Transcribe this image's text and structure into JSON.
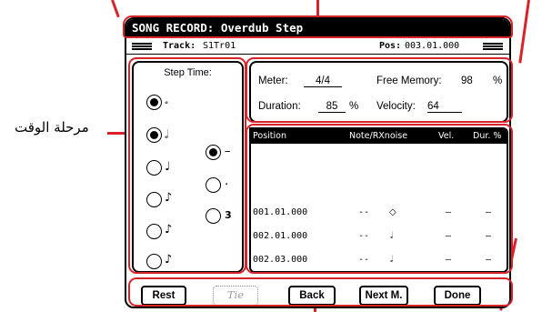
{
  "screen": {
    "title": "SONG RECORD:  Overdub Step",
    "track_label": "Track:",
    "track_value": "S1Tr01",
    "pos_label": "Pos:",
    "pos_value": "003.01.000"
  },
  "step_time": {
    "title": "Step Time:",
    "left_options": [
      {
        "icon": "whole-note-icon",
        "glyph": "𝅗𝅥",
        "selected": true
      },
      {
        "icon": "half-note-icon",
        "glyph": "𝅗𝅥",
        "selected": true
      },
      {
        "icon": "quarter-note-icon",
        "glyph": "♩",
        "selected": false
      },
      {
        "icon": "eighth-note-icon",
        "glyph": "♪",
        "selected": false
      },
      {
        "icon": "sixteenth-note-icon",
        "glyph": "𝅘𝅥𝅯",
        "selected": false
      },
      {
        "icon": "thirty-second-note-icon",
        "glyph": "𝅘𝅥𝅰",
        "selected": false
      }
    ],
    "right_options": [
      {
        "label": "–",
        "selected": true
      },
      {
        "label": ".",
        "selected": false
      },
      {
        "label": "3",
        "selected": false
      }
    ]
  },
  "info": {
    "meter_label": "Meter:",
    "meter_value": "4/4",
    "free_memory_label": "Free Memory:",
    "free_memory_value": "98",
    "free_memory_unit": "%",
    "duration_label": "Duration:",
    "duration_value": "85",
    "duration_unit": "%",
    "velocity_label": "Velocity:",
    "velocity_value": "64"
  },
  "table": {
    "headers": [
      "Position",
      "Note/RXnoise",
      "Vel.",
      "Dur. %"
    ],
    "rows": [
      {
        "position": "001.01.000",
        "note": "--",
        "symbol": "◇",
        "vel": "–",
        "dur": "–"
      },
      {
        "position": "002.01.000",
        "note": "--",
        "symbol": "𝅗𝅥",
        "vel": "–",
        "dur": "–"
      },
      {
        "position": "002.03.000",
        "note": "--",
        "symbol": "𝅗𝅥",
        "vel": "–",
        "dur": "–"
      }
    ]
  },
  "buttons": {
    "rest": "Rest",
    "tie": "Tie",
    "back": "Back",
    "next": "Next M.",
    "done": "Done"
  },
  "callout": {
    "step_time_label": "مرحلة الوقت"
  },
  "colors": {
    "callout": "#d8232a",
    "titlebar": "#000000"
  }
}
